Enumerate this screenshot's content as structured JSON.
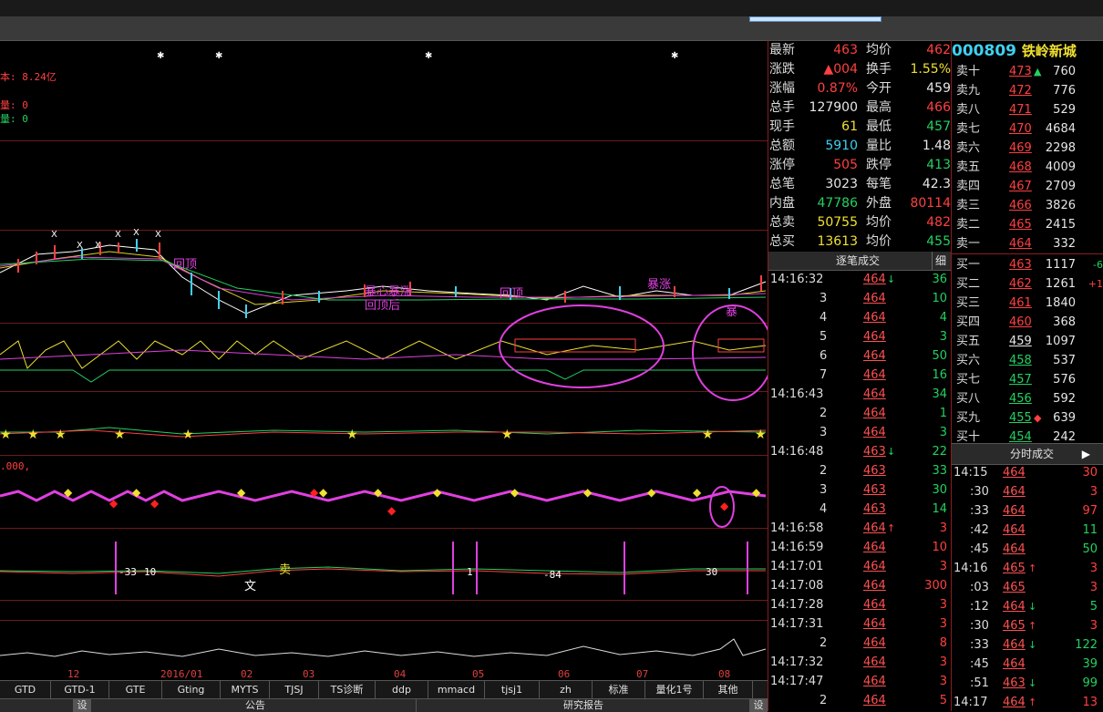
{
  "stock": {
    "code": "000809",
    "name": "铁岭新城"
  },
  "chart": {
    "info_capital": "本: 8.24亿",
    "info_vol1": "量: 0",
    "info_vol2": "量: 0",
    "osc_label": ".000,",
    "osc_values": [
      "-33",
      "10",
      "1",
      "-84",
      "30"
    ],
    "time_labels": [
      "12",
      "2016/01",
      "02",
      "03",
      "04",
      "05",
      "06",
      "07",
      "08"
    ],
    "annotations": [
      "涨",
      "跌",
      "文",
      "卖"
    ]
  },
  "quote": {
    "rows": [
      {
        "l1": "最新",
        "v1": "463",
        "c1": "red",
        "l2": "均价",
        "v2": "462",
        "c2": "red"
      },
      {
        "l1": "涨跌",
        "v1": "▲004",
        "c1": "red",
        "l2": "换手",
        "v2": "1.55%",
        "c2": "yellow"
      },
      {
        "l1": "涨幅",
        "v1": "0.87%",
        "c1": "red",
        "l2": "今开",
        "v2": "459",
        "c2": "white"
      },
      {
        "l1": "总手",
        "v1": "127900",
        "c1": "white",
        "l2": "最高",
        "v2": "466",
        "c2": "red"
      },
      {
        "l1": "现手",
        "v1": "61",
        "c1": "yellow",
        "l2": "最低",
        "v2": "457",
        "c2": "green"
      },
      {
        "l1": "总额",
        "v1": "5910",
        "c1": "cyan",
        "l2": "量比",
        "v2": "1.48",
        "c2": "white"
      },
      {
        "l1": "涨停",
        "v1": "505",
        "c1": "red",
        "l2": "跌停",
        "v2": "413",
        "c2": "green"
      },
      {
        "l1": "总笔",
        "v1": "3023",
        "c1": "white",
        "l2": "每笔",
        "v2": "42.3",
        "c2": "white"
      },
      {
        "l1": "内盘",
        "v1": "47786",
        "c1": "green",
        "l2": "外盘",
        "v2": "80114",
        "c2": "red"
      },
      {
        "l1": "总卖",
        "v1": "50755",
        "c1": "yellow",
        "l2": "均价",
        "v2": "482",
        "c2": "red"
      },
      {
        "l1": "总买",
        "v1": "13613",
        "c1": "yellow",
        "l2": "均价",
        "v2": "455",
        "c2": "green"
      }
    ]
  },
  "ticks": {
    "header": "逐笔成交",
    "header_btn": "细",
    "rows": [
      {
        "t": "14:16:32",
        "p": "464",
        "a": "↓",
        "ac": "green",
        "v": "36",
        "vc": "green"
      },
      {
        "t": "3",
        "p": "464",
        "a": "",
        "ac": "",
        "v": "10",
        "vc": "green"
      },
      {
        "t": "4",
        "p": "464",
        "a": "",
        "ac": "",
        "v": "4",
        "vc": "green"
      },
      {
        "t": "5",
        "p": "464",
        "a": "",
        "ac": "",
        "v": "3",
        "vc": "green"
      },
      {
        "t": "6",
        "p": "464",
        "a": "",
        "ac": "",
        "v": "50",
        "vc": "green"
      },
      {
        "t": "7",
        "p": "464",
        "a": "",
        "ac": "",
        "v": "16",
        "vc": "green"
      },
      {
        "t": "14:16:43",
        "p": "464",
        "a": "",
        "ac": "",
        "v": "34",
        "vc": "green"
      },
      {
        "t": "2",
        "p": "464",
        "a": "",
        "ac": "",
        "v": "1",
        "vc": "green"
      },
      {
        "t": "3",
        "p": "464",
        "a": "",
        "ac": "",
        "v": "3",
        "vc": "green"
      },
      {
        "t": "14:16:48",
        "p": "463",
        "a": "↓",
        "ac": "green",
        "v": "22",
        "vc": "green"
      },
      {
        "t": "2",
        "p": "463",
        "a": "",
        "ac": "",
        "v": "33",
        "vc": "green"
      },
      {
        "t": "3",
        "p": "463",
        "a": "",
        "ac": "",
        "v": "30",
        "vc": "green"
      },
      {
        "t": "4",
        "p": "463",
        "a": "",
        "ac": "",
        "v": "14",
        "vc": "green"
      },
      {
        "t": "14:16:58",
        "p": "464",
        "a": "↑",
        "ac": "red",
        "v": "3",
        "vc": "red"
      },
      {
        "t": "14:16:59",
        "p": "464",
        "a": "",
        "ac": "",
        "v": "10",
        "vc": "red"
      },
      {
        "t": "14:17:01",
        "p": "464",
        "a": "",
        "ac": "",
        "v": "3",
        "vc": "red"
      },
      {
        "t": "14:17:08",
        "p": "464",
        "a": "",
        "ac": "",
        "v": "300",
        "vc": "red"
      },
      {
        "t": "14:17:28",
        "p": "464",
        "a": "",
        "ac": "",
        "v": "3",
        "vc": "red"
      },
      {
        "t": "14:17:31",
        "p": "464",
        "a": "",
        "ac": "",
        "v": "3",
        "vc": "red"
      },
      {
        "t": "2",
        "p": "464",
        "a": "",
        "ac": "",
        "v": "8",
        "vc": "red"
      },
      {
        "t": "14:17:32",
        "p": "464",
        "a": "",
        "ac": "",
        "v": "3",
        "vc": "red"
      },
      {
        "t": "14:17:47",
        "p": "464",
        "a": "",
        "ac": "",
        "v": "3",
        "vc": "red"
      },
      {
        "t": "2",
        "p": "464",
        "a": "",
        "ac": "",
        "v": "5",
        "vc": "red"
      }
    ]
  },
  "orderbook": {
    "asks": [
      {
        "l": "卖十",
        "p": "473",
        "pc": "red",
        "m": "▲",
        "mc": "green",
        "v": "760"
      },
      {
        "l": "卖九",
        "p": "472",
        "pc": "red",
        "m": "",
        "mc": "",
        "v": "776"
      },
      {
        "l": "卖八",
        "p": "471",
        "pc": "red",
        "m": "",
        "mc": "",
        "v": "529"
      },
      {
        "l": "卖七",
        "p": "470",
        "pc": "red",
        "m": "",
        "mc": "",
        "v": "4684"
      },
      {
        "l": "卖六",
        "p": "469",
        "pc": "red",
        "m": "",
        "mc": "",
        "v": "2298"
      },
      {
        "l": "卖五",
        "p": "468",
        "pc": "red",
        "m": "",
        "mc": "",
        "v": "4009"
      },
      {
        "l": "卖四",
        "p": "467",
        "pc": "red",
        "m": "",
        "mc": "",
        "v": "2709"
      },
      {
        "l": "卖三",
        "p": "466",
        "pc": "red",
        "m": "",
        "mc": "",
        "v": "3826"
      },
      {
        "l": "卖二",
        "p": "465",
        "pc": "red",
        "m": "",
        "mc": "",
        "v": "2415"
      },
      {
        "l": "卖一",
        "p": "464",
        "pc": "red",
        "m": "",
        "mc": "",
        "v": "332"
      }
    ],
    "bids": [
      {
        "l": "买一",
        "p": "463",
        "pc": "red",
        "m": "",
        "mc": "",
        "v": "1117",
        "e": "-6",
        "ec": "green"
      },
      {
        "l": "买二",
        "p": "462",
        "pc": "red",
        "m": "",
        "mc": "",
        "v": "1261",
        "e": "+1",
        "ec": "red"
      },
      {
        "l": "买三",
        "p": "461",
        "pc": "red",
        "m": "",
        "mc": "",
        "v": "1840",
        "e": "",
        "ec": ""
      },
      {
        "l": "买四",
        "p": "460",
        "pc": "red",
        "m": "",
        "mc": "",
        "v": "368",
        "e": "",
        "ec": ""
      },
      {
        "l": "买五",
        "p": "459",
        "pc": "white",
        "m": "",
        "mc": "",
        "v": "1097",
        "e": "",
        "ec": ""
      },
      {
        "l": "买六",
        "p": "458",
        "pc": "green",
        "m": "",
        "mc": "",
        "v": "537",
        "e": "",
        "ec": ""
      },
      {
        "l": "买七",
        "p": "457",
        "pc": "green",
        "m": "",
        "mc": "",
        "v": "576",
        "e": "",
        "ec": ""
      },
      {
        "l": "买八",
        "p": "456",
        "pc": "green",
        "m": "",
        "mc": "",
        "v": "592",
        "e": "",
        "ec": ""
      },
      {
        "l": "买九",
        "p": "455",
        "pc": "green",
        "m": "◆",
        "mc": "red",
        "v": "639",
        "e": "",
        "ec": ""
      },
      {
        "l": "买十",
        "p": "454",
        "pc": "green",
        "m": "",
        "mc": "",
        "v": "242",
        "e": "",
        "ec": ""
      }
    ]
  },
  "fenshi": {
    "header": "分时成交",
    "rows": [
      {
        "t": "14:15",
        "p": "464",
        "a": "",
        "ac": "",
        "v": "30",
        "vc": "red"
      },
      {
        "t": ":30",
        "p": "464",
        "a": "",
        "ac": "",
        "v": "3",
        "vc": "red"
      },
      {
        "t": ":33",
        "p": "464",
        "a": "",
        "ac": "",
        "v": "97",
        "vc": "red"
      },
      {
        "t": ":42",
        "p": "464",
        "a": "",
        "ac": "",
        "v": "11",
        "vc": "green"
      },
      {
        "t": ":45",
        "p": "464",
        "a": "",
        "ac": "",
        "v": "50",
        "vc": "green"
      },
      {
        "t": "14:16",
        "p": "465",
        "a": "↑",
        "ac": "red",
        "v": "3",
        "vc": "red"
      },
      {
        "t": ":03",
        "p": "465",
        "a": "",
        "ac": "",
        "v": "3",
        "vc": "red"
      },
      {
        "t": ":12",
        "p": "464",
        "a": "↓",
        "ac": "green",
        "v": "5",
        "vc": "green"
      },
      {
        "t": ":30",
        "p": "465",
        "a": "↑",
        "ac": "red",
        "v": "3",
        "vc": "red"
      },
      {
        "t": ":33",
        "p": "464",
        "a": "↓",
        "ac": "green",
        "v": "122",
        "vc": "green"
      },
      {
        "t": ":45",
        "p": "464",
        "a": "",
        "ac": "",
        "v": "39",
        "vc": "green"
      },
      {
        "t": ":51",
        "p": "463",
        "a": "↓",
        "ac": "green",
        "v": "99",
        "vc": "green"
      },
      {
        "t": "14:17",
        "p": "464",
        "a": "↑",
        "ac": "red",
        "v": "13",
        "vc": "red"
      }
    ]
  },
  "tabs": [
    "GTD",
    "GTD-1",
    "GTE",
    "Gting",
    "MYTS",
    "TJSJ",
    "TS诊断",
    "ddp",
    "mmacd",
    "tjsj1",
    "zh",
    "标准",
    "量化1号",
    "其他"
  ],
  "bottom": {
    "left_btn": "设",
    "announce": "公告",
    "research": "研究报告",
    "right_btn": "设"
  },
  "colors": {
    "up": "#ff4040",
    "down": "#23d160",
    "grid": "#6b1a1a",
    "highlight": "#e040e0"
  }
}
